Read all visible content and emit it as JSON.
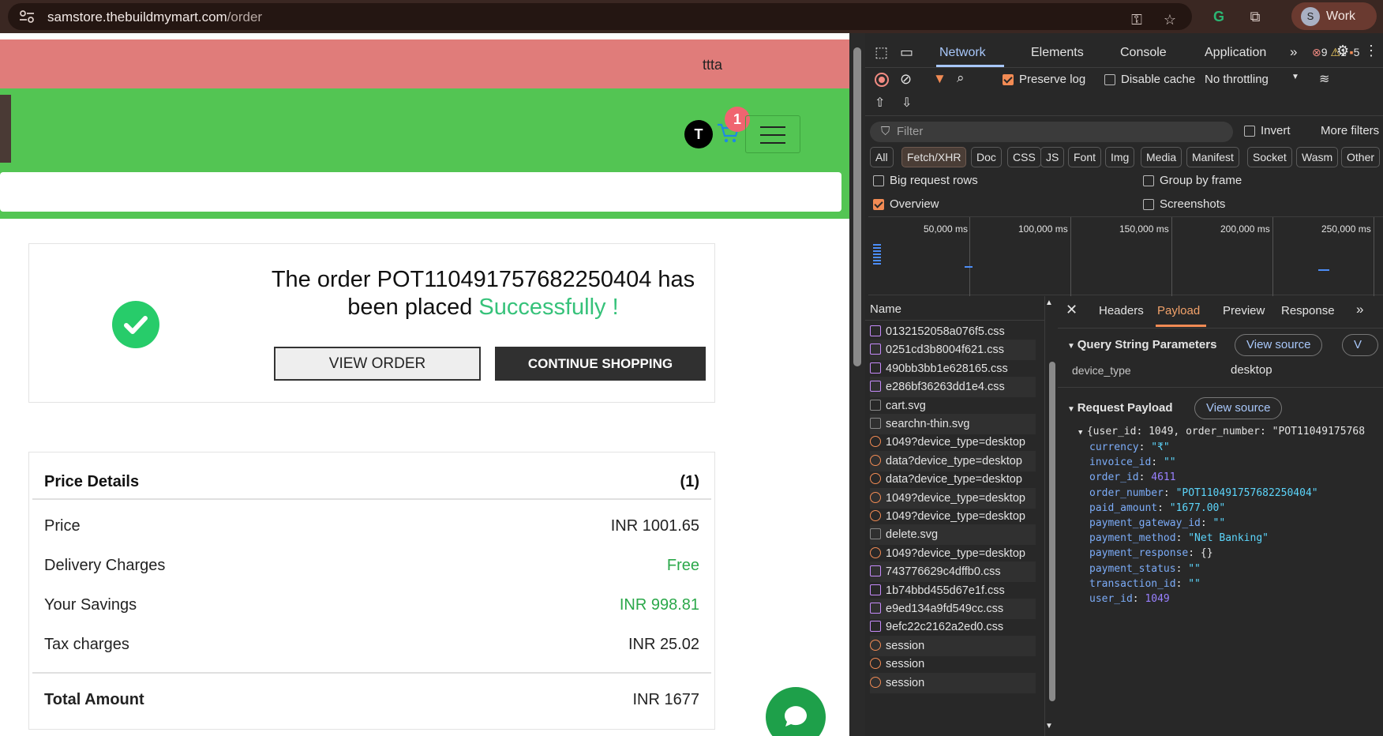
{
  "browser": {
    "url_host": "samstore.thebuildmymart.com",
    "url_path": "/order",
    "profile_initial": "S",
    "profile_label": "Work"
  },
  "site": {
    "username": "ttta",
    "avatar_initial": "T",
    "cart_count": "1",
    "order": {
      "title_prefix": "The order POT110491757682250404 has been placed",
      "title_success": "Successfully !",
      "view_order_label": "VIEW ORDER",
      "continue_label": "CONTINUE SHOPPING"
    },
    "price": {
      "header": "Price Details",
      "count": "(1)",
      "rows": [
        {
          "label": "Price",
          "value": "INR 1001.65"
        },
        {
          "label": "Delivery Charges",
          "value": "Free"
        },
        {
          "label": "Your Savings",
          "value": "INR 998.81"
        },
        {
          "label": "Tax charges",
          "value": "INR 25.02"
        }
      ],
      "total_label": "Total Amount",
      "total_value": "INR 1677"
    }
  },
  "devtools": {
    "tabs": [
      "Network",
      "Elements",
      "Console",
      "Application"
    ],
    "errors": "9",
    "warnings": "1",
    "issues": "5",
    "toolbar": {
      "preserve_log": "Preserve log",
      "disable_cache": "Disable cache",
      "throttling": "No throttling"
    },
    "filter_placeholder": "Filter",
    "invert": "Invert",
    "more_filters": "More filters",
    "type_filters": [
      "All",
      "Fetch/XHR",
      "Doc",
      "CSS",
      "JS",
      "Font",
      "Img",
      "Media",
      "Manifest",
      "Socket",
      "Wasm",
      "Other"
    ],
    "options": {
      "big_rows": "Big request rows",
      "group_frame": "Group by frame",
      "overview": "Overview",
      "screenshots": "Screenshots"
    },
    "timeline_labels": [
      "50,000 ms",
      "100,000 ms",
      "150,000 ms",
      "200,000 ms",
      "250,000 ms"
    ],
    "name_header": "Name",
    "requests": [
      {
        "name": "0132152058a076f5.css",
        "type": "css"
      },
      {
        "name": "0251cd3b8004f621.css",
        "type": "css"
      },
      {
        "name": "490bb3bb1e628165.css",
        "type": "css"
      },
      {
        "name": "e286bf36263dd1e4.css",
        "type": "css"
      },
      {
        "name": "cart.svg",
        "type": "img"
      },
      {
        "name": "searchn-thin.svg",
        "type": "img"
      },
      {
        "name": "1049?device_type=desktop",
        "type": "xhr"
      },
      {
        "name": "data?device_type=desktop",
        "type": "xhr"
      },
      {
        "name": "data?device_type=desktop",
        "type": "xhr"
      },
      {
        "name": "1049?device_type=desktop",
        "type": "xhr"
      },
      {
        "name": "1049?device_type=desktop",
        "type": "xhr"
      },
      {
        "name": "delete.svg",
        "type": "img"
      },
      {
        "name": "1049?device_type=desktop",
        "type": "xhr"
      },
      {
        "name": "743776629c4dffb0.css",
        "type": "css"
      },
      {
        "name": "1b74bbd455d67e1f.css",
        "type": "css"
      },
      {
        "name": "e9ed134a9fd549cc.css",
        "type": "css"
      },
      {
        "name": "9efc22c2162a2ed0.css",
        "type": "css"
      },
      {
        "name": "session",
        "type": "xhr"
      },
      {
        "name": "session",
        "type": "xhr"
      },
      {
        "name": "session",
        "type": "xhr"
      }
    ],
    "detail_tabs": [
      "Headers",
      "Payload",
      "Preview",
      "Response"
    ],
    "qsp_title": "Query String Parameters",
    "view_source": "View source",
    "view_source_truncated": "V",
    "qsp_key": "device_type",
    "qsp_value": "desktop",
    "payload_title": "Request Payload",
    "payload_summary": "{user_id: 1049, order_number: \"POT11049175768",
    "payload": [
      {
        "key": "currency",
        "value": "\"₹\"",
        "kind": "s"
      },
      {
        "key": "invoice_id",
        "value": "\"\"",
        "kind": "s"
      },
      {
        "key": "order_id",
        "value": "4611",
        "kind": "n"
      },
      {
        "key": "order_number",
        "value": "\"POT110491757682250404\"",
        "kind": "s"
      },
      {
        "key": "paid_amount",
        "value": "\"1677.00\"",
        "kind": "s"
      },
      {
        "key": "payment_gateway_id",
        "value": "\"\"",
        "kind": "s"
      },
      {
        "key": "payment_method",
        "value": "\"Net Banking\"",
        "kind": "s"
      },
      {
        "key": "payment_response",
        "value": "{}",
        "kind": "p"
      },
      {
        "key": "payment_status",
        "value": "\"\"",
        "kind": "s"
      },
      {
        "key": "transaction_id",
        "value": "\"\"",
        "kind": "s"
      },
      {
        "key": "user_id",
        "value": "1049",
        "kind": "n"
      }
    ]
  }
}
